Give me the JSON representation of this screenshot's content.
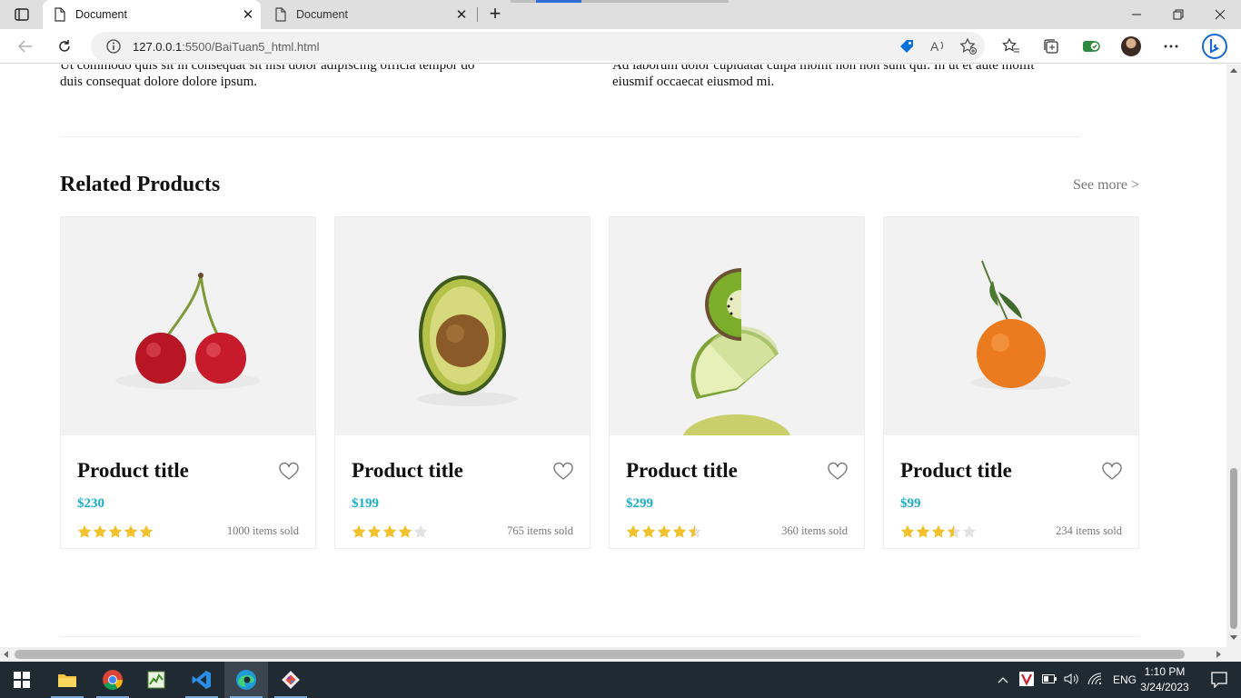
{
  "browser": {
    "tabs": [
      {
        "title": "Document",
        "active": true
      },
      {
        "title": "Document",
        "active": false
      }
    ],
    "url_host": "127.0.0.1",
    "url_path": ":5500/BaiTuan5_html.html"
  },
  "page": {
    "paragraph_left_line1": "Ut commodo quis sit in consequat sit nisi dolor adipiscing officia tempor do",
    "paragraph_left_line2": "duis consequat dolore dolore ipsum.",
    "paragraph_right_line1": "Ad laborum dolor cupidatat culpa mollit non non sunt qui. In ut et aute mollit",
    "paragraph_right_line2": "eiusmif occaecat eiusmod mi.",
    "section_title": "Related Products",
    "see_more": "See more >",
    "products": [
      {
        "title": "Product title",
        "price": "$230",
        "rating": 5,
        "sold": "1000 items sold",
        "image": "cherries"
      },
      {
        "title": "Product title",
        "price": "$199",
        "rating": 4,
        "sold": "765 items sold",
        "image": "avocado"
      },
      {
        "title": "Product title",
        "price": "$299",
        "rating": 4.5,
        "sold": "360 items sold",
        "image": "kiwi-lime"
      },
      {
        "title": "Product title",
        "price": "$99",
        "rating": 3.5,
        "sold": "234 items sold",
        "image": "tangerine"
      }
    ],
    "colors": {
      "price": "#19b0c8",
      "star": "#f2c12e",
      "star_empty": "#e3e3e3"
    }
  },
  "taskbar": {
    "apps": [
      "windows-start",
      "file-explorer",
      "chrome",
      "task-manager",
      "vscode",
      "edge",
      "git"
    ],
    "language": "ENG",
    "time": "1:10 PM",
    "date": "3/24/2023"
  }
}
